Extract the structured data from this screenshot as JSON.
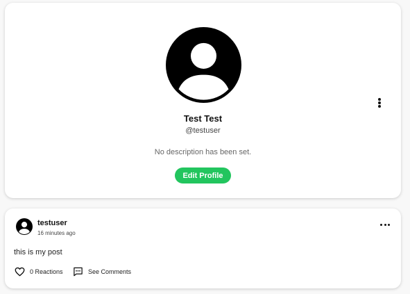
{
  "profile": {
    "name": "Test Test",
    "handle": "@testuser",
    "description": "No description has been set.",
    "edit_label": "Edit Profile",
    "avatar_icon": "user-avatar-icon",
    "menu_icon": "vertical-dots-icon"
  },
  "post": {
    "username": "testuser",
    "time": "16 minutes ago",
    "body": "this is my post",
    "menu_icon": "horizontal-dots-icon",
    "reactions_label": "0 Reactions",
    "reactions_icon": "heart-icon",
    "comments_label": "See Comments",
    "comments_icon": "comment-icon"
  },
  "colors": {
    "accent": "#22c55e",
    "card": "#ffffff",
    "background": "#f8f8f8"
  }
}
